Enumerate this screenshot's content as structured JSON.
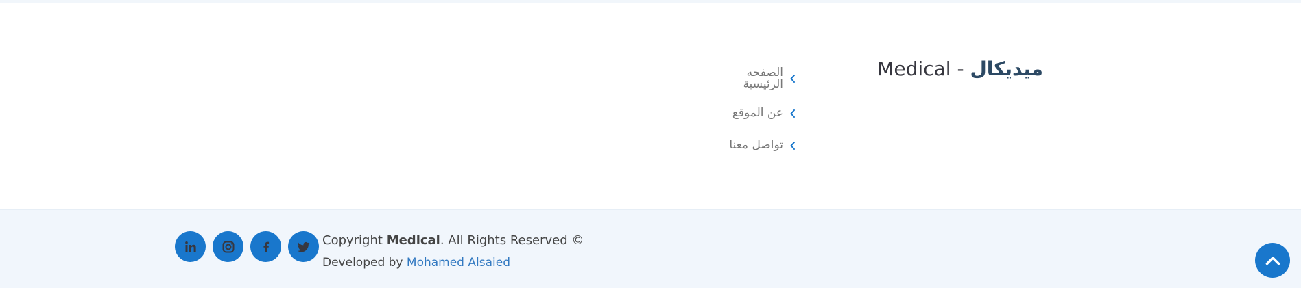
{
  "brand": {
    "name_en": "Medical",
    "separator": "-",
    "name_ar": "ميديكال"
  },
  "footer_links": [
    {
      "label": "الصفحه الرئيسية",
      "icon": "chevron-left-icon"
    },
    {
      "label": "عن الموقع",
      "icon": "chevron-left-icon"
    },
    {
      "label": "تواصل معنا",
      "icon": "chevron-left-icon"
    }
  ],
  "social": [
    {
      "name": "linkedin-icon"
    },
    {
      "name": "instagram-icon"
    },
    {
      "name": "facebook-icon"
    },
    {
      "name": "twitter-icon"
    }
  ],
  "copyright": {
    "prefix": "Copyright",
    "brand": "Medical",
    "suffix": ". All Rights Reserved ©"
  },
  "credits": {
    "prefix": "Developed by",
    "author": "Mohamed Alsaied"
  },
  "colors": {
    "accent": "#1977cc",
    "heading": "#2c4964",
    "footer_bg": "#f1f6fc",
    "link_text": "#777777"
  }
}
